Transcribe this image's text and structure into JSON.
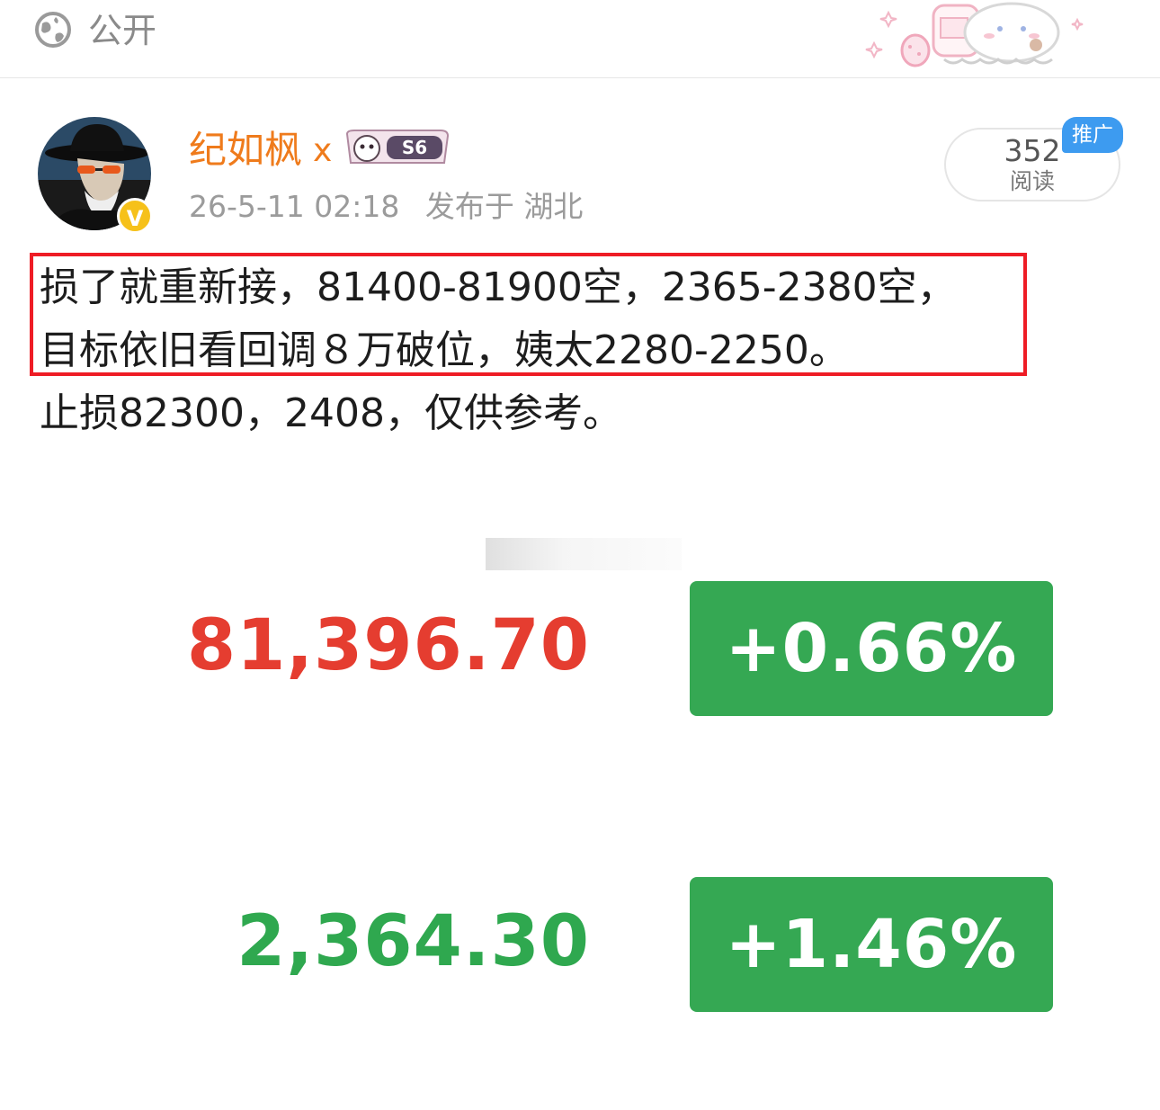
{
  "topbar": {
    "visibility_label": "公开",
    "globe_icon": "globe-icon",
    "sticker": "cute-sticker-decoration"
  },
  "post": {
    "author": {
      "name": "纪如枫",
      "name_suffix": "x",
      "verified_icon": "v-verified-icon",
      "badge_text": "S6"
    },
    "meta": {
      "time": "26-5-11 02:18",
      "location": "发布于 湖北"
    },
    "reads": {
      "count": "352",
      "label": "阅读",
      "promo_tag": "推广"
    },
    "body_lines": [
      "损了就重新接，81400-81900空，2365-2380空，",
      "目标依旧看回调８万破位，姨太2280-2250。",
      "止损82300，2408，仅供参考。"
    ]
  },
  "quotes": [
    {
      "price": "81,396.70",
      "change": "+0.66%",
      "price_color": "#e53d30",
      "change_color": "#35a853"
    },
    {
      "price": "2,364.30",
      "change": "+1.46%",
      "price_color": "#2fa84f",
      "change_color": "#35a853"
    }
  ],
  "colors": {
    "accent_orange": "#ef7b1c",
    "highlight_red": "#ee1c25",
    "promo_blue": "#3d9bf0"
  }
}
